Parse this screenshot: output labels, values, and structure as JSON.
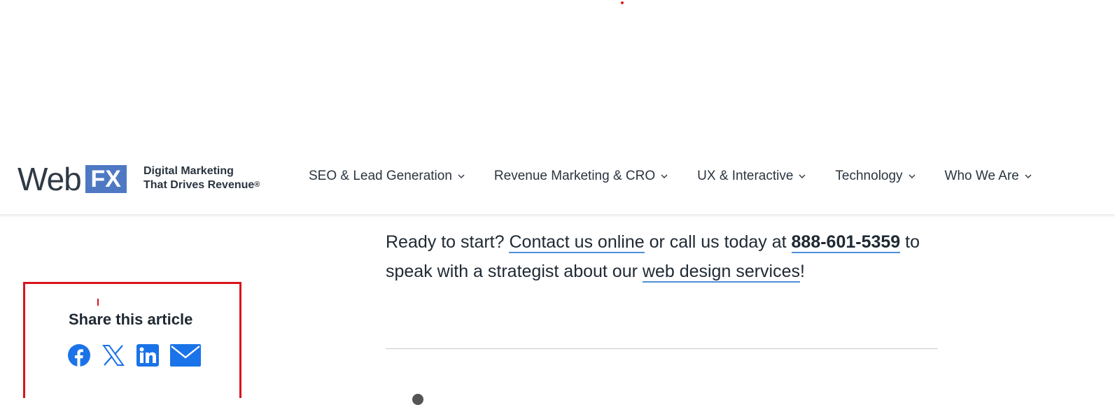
{
  "brand": {
    "logo_web": "Web",
    "logo_fx": "FX",
    "tagline_line1": "Digital Marketing",
    "tagline_line2": "That Drives Revenue",
    "tagline_mark": "®",
    "accent_color": "#4e79c2"
  },
  "nav": {
    "items": [
      {
        "label": "SEO & Lead Generation",
        "icon": "chevron-down-icon"
      },
      {
        "label": "Revenue Marketing & CRO",
        "icon": "chevron-down-icon"
      },
      {
        "label": "UX & Interactive",
        "icon": "chevron-down-icon"
      },
      {
        "label": "Technology",
        "icon": "chevron-down-icon"
      },
      {
        "label": "Who We Are",
        "icon": "chevron-down-icon"
      }
    ]
  },
  "article": {
    "cta_prefix": "Ready to start?",
    "contact_link": "Contact us online",
    "cta_middle": "or call us today at",
    "phone": "888-601-5359",
    "cta_after_phone": "to speak with a strategist about our",
    "services_link": "web design services",
    "cta_end": "!"
  },
  "share": {
    "title": "Share this article",
    "highlight_color": "#d8141c",
    "icons": [
      "facebook-icon",
      "x-icon",
      "linkedin-icon",
      "email-icon"
    ],
    "icon_color": "#1a73e8"
  }
}
